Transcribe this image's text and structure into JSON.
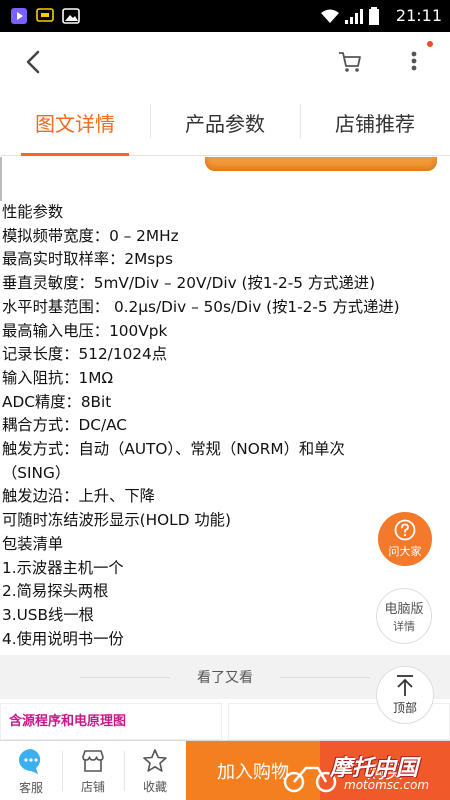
{
  "status_bar": {
    "time": "21:11"
  },
  "tabs": [
    {
      "label": "图文详情"
    },
    {
      "label": "产品参数"
    },
    {
      "label": "店铺推荐"
    }
  ],
  "spec_lines": [
    "性能参数",
    "模拟频带宽度：0 – 2MHz",
    "最高实时取样率：2Msps",
    "垂直灵敏度：5mV/Div – 20V/Div (按1-2-5 方式递进)",
    "水平时基范围： 0.2μs/Div – 50s/Div (按1-2-5 方式递进)",
    "最高输入电压：100Vpk",
    "记录长度：512/1024点",
    "输入阻抗：1MΩ",
    "ADC精度：8Bit",
    "耦合方式：DC/AC",
    "触发方式：自动（AUTO）、常规（NORM）和单次",
    "（SING）",
    "触发边沿：上升、下降",
    "可随时冻结波形显示(HOLD 功能)",
    "包装清单",
    "1.示波器主机一个",
    "2.简易探头两根",
    "3.USB线一根",
    "4.使用说明书一份"
  ],
  "more_section": {
    "label": "看了又看"
  },
  "reco": {
    "card1_text": "含源程序和电原理图"
  },
  "floating": {
    "ask_label": "问大家",
    "pc_line1": "电脑版",
    "pc_line2": "详情",
    "top_label": "顶部"
  },
  "bottom_bar": {
    "service_label": "客服",
    "shop_label": "店铺",
    "favorite_label": "收藏",
    "add_to_cart_label": "加入购物",
    "buy_now_label": "购买"
  },
  "watermark": {
    "main": "摩托中国",
    "sub": "motomsc.com"
  },
  "colors": {
    "accent": "#f26b1d",
    "add_to_cart_bg": "#f47f1f",
    "buy_now_bg": "#f0592a",
    "ask_fab_bg": "#f27a2a",
    "status_bar_bg": "#000000"
  }
}
